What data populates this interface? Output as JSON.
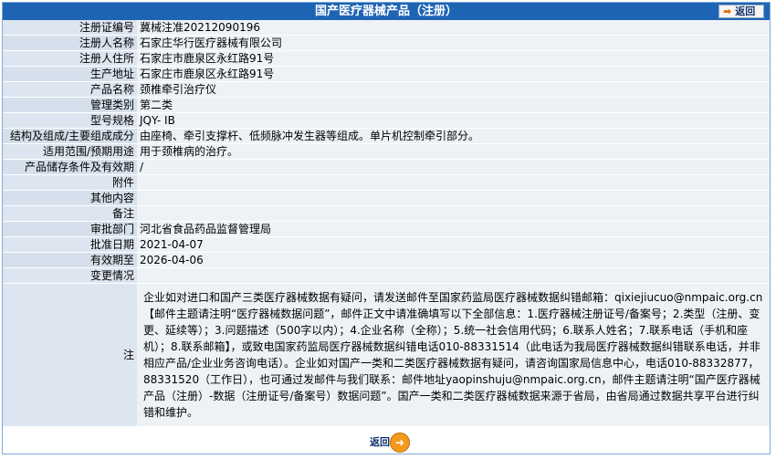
{
  "header": {
    "title": "国产医疗器械产品（注册）",
    "back_label": "返回",
    "back_icon": "arrow-right-icon"
  },
  "rows": [
    {
      "label": "注册证编号",
      "value": "冀械注准20212090196"
    },
    {
      "label": "注册人名称",
      "value": "石家庄华行医疗器械有限公司"
    },
    {
      "label": "注册人住所",
      "value": "石家庄市鹿泉区永红路91号"
    },
    {
      "label": "生产地址",
      "value": "石家庄市鹿泉区永红路91号"
    },
    {
      "label": "产品名称",
      "value": "颈椎牵引治疗仪"
    },
    {
      "label": "管理类别",
      "value": "第二类"
    },
    {
      "label": "型号规格",
      "value": "JQY- IB"
    },
    {
      "label": "结构及组成/主要组成成分",
      "value": "由座椅、牵引支撑杆、低频脉冲发生器等组成。单片机控制牵引部分。"
    },
    {
      "label": "适用范围/预期用途",
      "value": "用于颈椎病的治疗。"
    },
    {
      "label": "产品储存条件及有效期",
      "value": "/"
    },
    {
      "label": "附件",
      "value": ""
    },
    {
      "label": "其他内容",
      "value": ""
    },
    {
      "label": "备注",
      "value": ""
    },
    {
      "label": "审批部门",
      "value": "河北省食品药品监督管理局"
    },
    {
      "label": "批准日期",
      "value": "2021-04-07"
    },
    {
      "label": "有效期至",
      "value": "2026-04-06"
    },
    {
      "label": "变更情况",
      "value": ""
    }
  ],
  "note": {
    "label": "注",
    "text": "企业如对进口和国产三类医疗器械数据有疑问，请发送邮件至国家药监局医疗器械数据纠错邮箱：qixiejiucuo@nmpaic.org.cn【邮件主题请注明“医疗器械数据问题”，邮件正文中请准确填写以下全部信息：1.医疗器械注册证号/备案号；2.类型（注册、变更、延续等）；3.问题描述（500字以内）；4.企业名称（全称）；5.统一社会信用代码；6.联系人姓名；7.联系电话（手机和座机）；8.联系邮箱】，或致电国家药监局医疗器械数据纠错电话010-88331514（此电话为我局医疗器械数据纠错联系电话，并非相应产品/企业业务咨询电话）。企业如对国产一类和二类医疗器械数据有疑问，请咨询国家局信息中心，电话010-88332877，88331520（工作日），也可通过发邮件与我们联系：邮件地址yaopinshuju@nmpaic.org.cn，邮件主题请注明“国产医疗器械产品（注册）-数据（注册证号/备案号）数据问题”。国产一类和二类医疗器械数据来源于省局，由省局通过数据共享平台进行纠错和维护。"
  },
  "footer": {
    "back_label": "返回",
    "back_icon": "circle-arrow-icon"
  },
  "colors": {
    "header_bg": "#1e64b4",
    "label_bg": "#dde5f0",
    "value_bg": "#eef2f7",
    "accent": "#f39a1d"
  }
}
